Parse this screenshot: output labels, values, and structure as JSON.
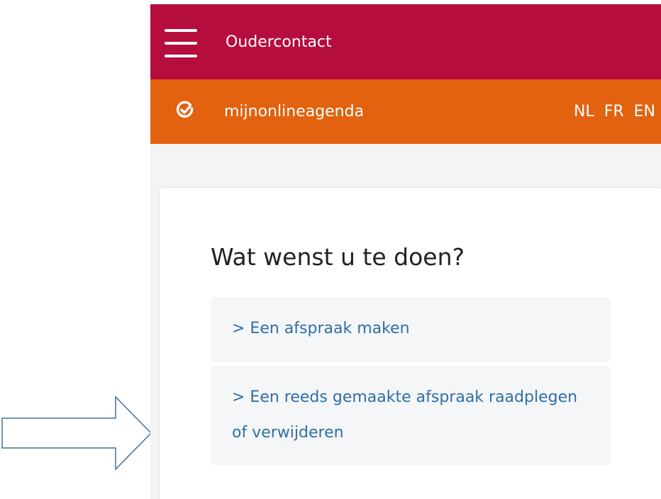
{
  "topbar": {
    "menu_icon": "hamburger-menu-icon",
    "title": "Oudercontact",
    "color": "#b60d3f"
  },
  "brandbar": {
    "icon": "check-circle-icon",
    "name": "mijnonlineagenda",
    "color": "#e2620f",
    "languages": [
      "NL",
      "FR",
      "EN"
    ]
  },
  "card": {
    "title": "Wat wenst u te doen?",
    "options": [
      {
        "label": "> Een afspraak maken"
      },
      {
        "label": "> Een reeds gemaakte afspraak raadplegen of verwijderen"
      }
    ]
  },
  "annotation": {
    "icon": "right-arrow-outline-icon",
    "stroke_color": "#41719c"
  }
}
